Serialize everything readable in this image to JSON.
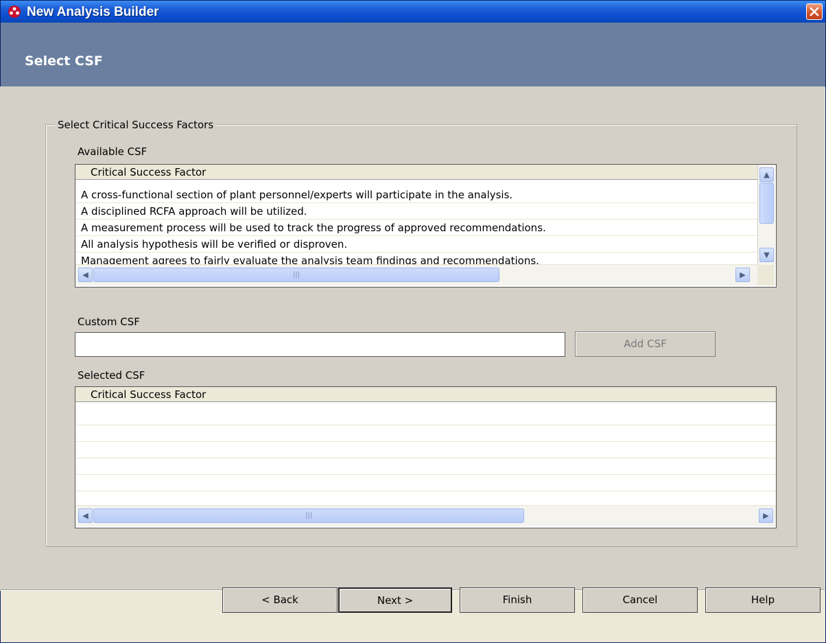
{
  "window": {
    "title": "New Analysis Builder",
    "step_title": "Select CSF"
  },
  "group": {
    "legend": "Select Critical Success Factors"
  },
  "available": {
    "label": "Available CSF",
    "column_header": "Critical Success Factor",
    "rows": [
      "A cross-functional section of plant personnel/experts will participate in the analysis.",
      "A disciplined RCFA approach will be utilized.",
      "A measurement process will be used to track the progress of approved recommendations.",
      "All analysis hypothesis will be verified or disproven.",
      "Management agrees to fairly evaluate the analysis team findings and recommendations."
    ]
  },
  "custom": {
    "label": "Custom CSF",
    "value": "",
    "add_button": "Add CSF"
  },
  "selected": {
    "label": "Selected CSF",
    "column_header": "Critical Success Factor",
    "rows": []
  },
  "buttons": {
    "back": "< Back",
    "next": "Next >",
    "finish": "Finish",
    "cancel": "Cancel",
    "help": "Help"
  },
  "colors": {
    "titlebar": "#0a4dcf",
    "header": "#6b80a0",
    "body": "#d4d0c8"
  }
}
